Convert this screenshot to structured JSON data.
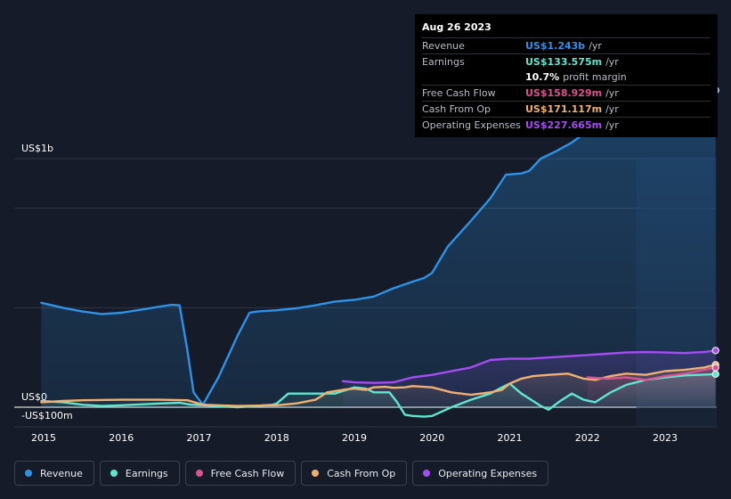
{
  "tooltip": {
    "date": "Aug 26 2023",
    "rows": [
      {
        "label": "Revenue",
        "value": "US$1.243b",
        "unit": "/yr",
        "color": "#2e93e8"
      },
      {
        "label": "Earnings",
        "value": "US$133.575m",
        "unit": "/yr",
        "color": "#5fe6cf"
      },
      {
        "label": "",
        "value": "10.7%",
        "unit": "profit margin",
        "color": "#ffffff"
      },
      {
        "label": "Free Cash Flow",
        "value": "US$158.929m",
        "unit": "/yr",
        "color": "#d9548f"
      },
      {
        "label": "Cash From Op",
        "value": "US$171.117m",
        "unit": "/yr",
        "color": "#f0b071"
      },
      {
        "label": "Operating Expenses",
        "value": "US$227.665m",
        "unit": "/yr",
        "color": "#a44df2"
      }
    ]
  },
  "legend": [
    {
      "label": "Revenue",
      "color": "#2e93e8"
    },
    {
      "label": "Earnings",
      "color": "#5fe6cf"
    },
    {
      "label": "Free Cash Flow",
      "color": "#d9548f"
    },
    {
      "label": "Cash From Op",
      "color": "#f0b071"
    },
    {
      "label": "Operating Expenses",
      "color": "#a44df2"
    }
  ],
  "chart_data": {
    "type": "area",
    "title": "",
    "xlabel": "",
    "ylabel": "",
    "y_tick_labels": [
      "US$1b",
      "US$0",
      "-US$100m"
    ],
    "x_tick_labels": [
      "2015",
      "2016",
      "2017",
      "2018",
      "2019",
      "2020",
      "2021",
      "2022",
      "2023"
    ],
    "xlim": [
      2014.97,
      2023.65
    ],
    "ylim": [
      -100,
      1310
    ],
    "highlight_start": 2022.63,
    "grid": true,
    "series": [
      {
        "name": "Revenue",
        "color": "#2e93e8",
        "x": [
          2014.97,
          2015.25,
          2015.5,
          2015.75,
          2016.0,
          2016.25,
          2016.5,
          2016.65,
          2016.75,
          2016.85,
          2016.93,
          2017.05,
          2017.25,
          2017.5,
          2017.65,
          2017.75,
          2018.0,
          2018.25,
          2018.5,
          2018.75,
          2019.0,
          2019.25,
          2019.5,
          2019.75,
          2019.9,
          2020.0,
          2020.2,
          2020.5,
          2020.75,
          2020.95,
          2021.15,
          2021.25,
          2021.4,
          2021.6,
          2021.8,
          2022.0,
          2022.15,
          2022.3,
          2022.5,
          2022.65,
          2022.8,
          2023.0,
          2023.25,
          2023.45,
          2023.58,
          2023.65
        ],
        "values": [
          420,
          400,
          385,
          375,
          380,
          392,
          405,
          412,
          410,
          230,
          60,
          10,
          120,
          290,
          380,
          385,
          390,
          398,
          410,
          425,
          432,
          445,
          478,
          505,
          520,
          540,
          645,
          750,
          840,
          935,
          940,
          950,
          1000,
          1030,
          1065,
          1110,
          1160,
          1185,
          1210,
          1215,
          1225,
          1240,
          1242,
          1245,
          1255,
          1275
        ]
      },
      {
        "name": "Earnings",
        "color": "#5fe6cf",
        "x": [
          2014.97,
          2015.25,
          2015.5,
          2015.75,
          2016.0,
          2016.5,
          2016.75,
          2016.9,
          2017.05,
          2017.5,
          2017.95,
          2018.0,
          2018.15,
          2018.5,
          2018.75,
          2019.0,
          2019.15,
          2019.25,
          2019.45,
          2019.55,
          2019.65,
          2019.75,
          2019.9,
          2020.0,
          2020.25,
          2020.5,
          2020.75,
          2020.9,
          2021.0,
          2021.15,
          2021.3,
          2021.4,
          2021.5,
          2021.65,
          2021.8,
          2021.95,
          2022.1,
          2022.3,
          2022.5,
          2022.75,
          2023.0,
          2023.25,
          2023.65
        ],
        "values": [
          25,
          20,
          10,
          5,
          8,
          15,
          18,
          10,
          8,
          0,
          10,
          15,
          55,
          55,
          55,
          80,
          75,
          60,
          60,
          20,
          -30,
          -35,
          -38,
          -35,
          0,
          30,
          55,
          80,
          95,
          55,
          25,
          5,
          -10,
          25,
          55,
          30,
          20,
          60,
          90,
          110,
          120,
          128,
          133
        ]
      },
      {
        "name": "Free Cash Flow",
        "color": "#d9548f",
        "x": [
          2022.0,
          2022.25,
          2022.5,
          2022.75,
          2023.0,
          2023.25,
          2023.5,
          2023.65
        ],
        "values": [
          120,
          115,
          120,
          110,
          125,
          135,
          150,
          159
        ]
      },
      {
        "name": "Cash From Op",
        "color": "#f0b071",
        "x": [
          2014.97,
          2015.25,
          2015.5,
          2016.0,
          2016.5,
          2016.85,
          2017.05,
          2017.5,
          2018.0,
          2018.25,
          2018.5,
          2018.65,
          2018.85,
          2019.0,
          2019.15,
          2019.25,
          2019.4,
          2019.5,
          2019.65,
          2019.75,
          2020.0,
          2020.25,
          2020.5,
          2020.75,
          2020.9,
          2021.0,
          2021.15,
          2021.3,
          2021.5,
          2021.75,
          2021.95,
          2022.1,
          2022.3,
          2022.5,
          2022.75,
          2023.0,
          2023.25,
          2023.5,
          2023.65
        ],
        "values": [
          20,
          25,
          28,
          30,
          30,
          28,
          10,
          5,
          8,
          15,
          30,
          60,
          70,
          75,
          70,
          80,
          82,
          78,
          80,
          85,
          80,
          60,
          50,
          60,
          70,
          95,
          115,
          125,
          130,
          135,
          115,
          110,
          125,
          135,
          130,
          145,
          150,
          160,
          171
        ]
      },
      {
        "name": "Operating Expenses",
        "color": "#a44df2",
        "x": [
          2018.85,
          2019.0,
          2019.25,
          2019.5,
          2019.75,
          2020.0,
          2020.25,
          2020.5,
          2020.75,
          2021.0,
          2021.25,
          2021.5,
          2021.75,
          2022.0,
          2022.25,
          2022.5,
          2022.75,
          2023.0,
          2023.25,
          2023.5,
          2023.65
        ],
        "values": [
          105,
          100,
          98,
          100,
          120,
          130,
          145,
          160,
          190,
          195,
          195,
          200,
          205,
          210,
          215,
          220,
          222,
          220,
          218,
          222,
          228
        ]
      }
    ]
  }
}
